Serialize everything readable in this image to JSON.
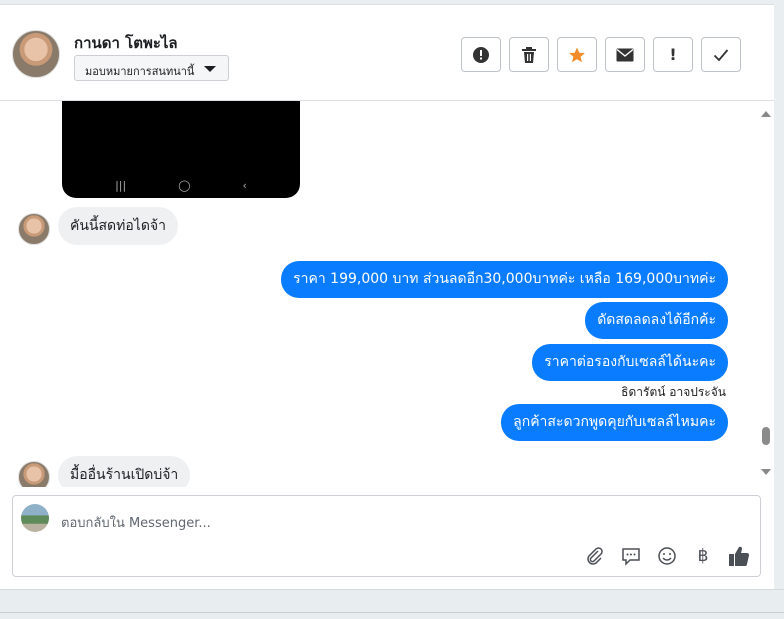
{
  "header": {
    "contact_name": "กานดา โตพะไล",
    "assign_label": "มอบหมายการสนทนานี้",
    "actions": [
      {
        "name": "alert-button",
        "glyph": "!"
      },
      {
        "name": "trash-button",
        "glyph": "🗑"
      },
      {
        "name": "star-button",
        "glyph": "★"
      },
      {
        "name": "envelope-button",
        "glyph": "✉"
      },
      {
        "name": "important-button",
        "glyph": "!"
      },
      {
        "name": "done-button",
        "glyph": "✓"
      }
    ]
  },
  "messages": {
    "in_1": "คันนี้สดท่อไดจ้า",
    "out_1": "ราคา 199,000 บาท ส่วนลดอีก30,000บาทค่ะ เหลือ 169,000บาทค่ะ",
    "out_2": "ดัดสดลดลงได้อีกค้ะ",
    "out_3": "ราคาต่อรองกับเซลล์ได้นะคะ",
    "sender": "ธิดารัตน์ อาจประจัน",
    "out_4": "ลูกค้าสะดวกพูดคุยกับเซลล์ไหมคะ",
    "in_2": "มื้ออื่นร้านเปิดบ่จ้า"
  },
  "composer": {
    "placeholder": "ตอบกลับใน Messenger...",
    "tools": [
      "paperclip-icon",
      "chat-bubble-icon",
      "smiley-icon",
      "baht-icon",
      "thumbs-up-icon"
    ]
  },
  "colors": {
    "outgoing": "#0a7cff",
    "incoming": "#eff0f2",
    "star": "#f28c28"
  }
}
